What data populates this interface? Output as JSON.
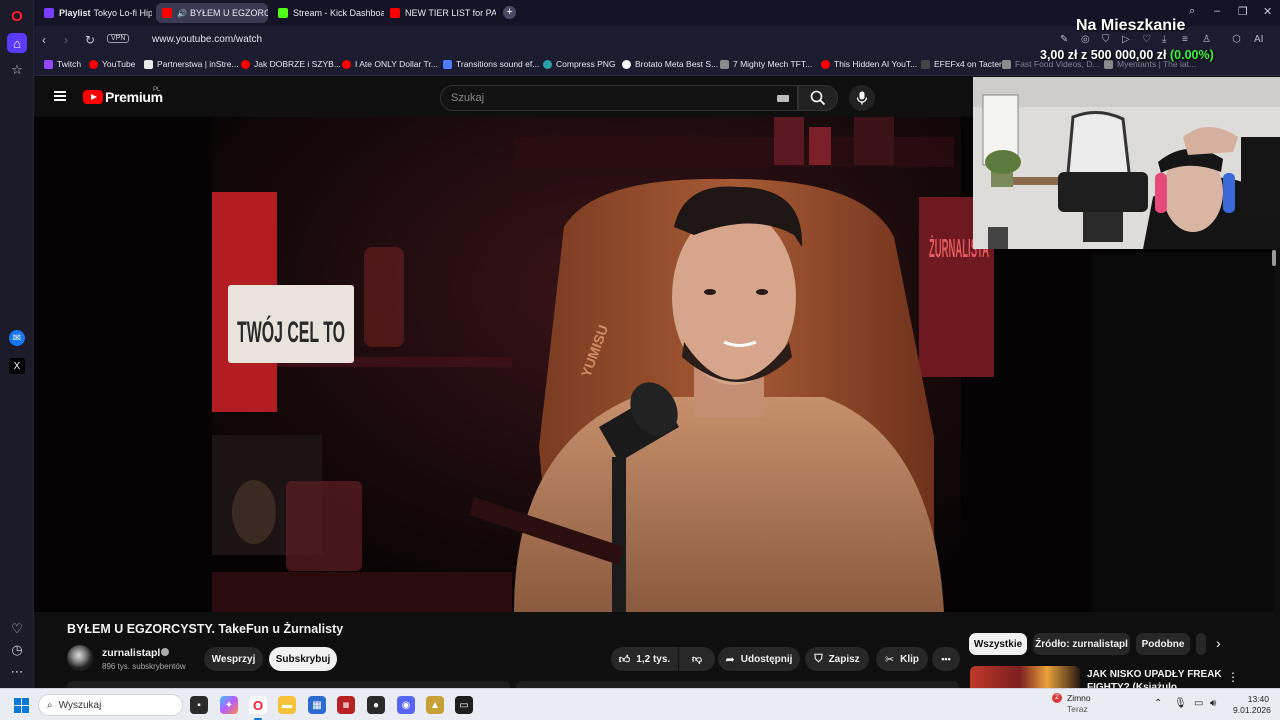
{
  "browser": {
    "tabs": [
      {
        "bold": "Playlist",
        "text": "Tokyo Lo-fi Hiphop",
        "icon": "lofi"
      },
      {
        "bold": "",
        "text": "BYŁEM U EGZORCYSTY",
        "icon": "youtube"
      },
      {
        "bold": "",
        "text": "Stream - Kick Dashboard",
        "icon": "kick"
      },
      {
        "bold": "",
        "text": "NEW TIER LIST for PATCH",
        "icon": "youtube"
      }
    ],
    "new_tab": "+",
    "url": "www.youtube.com/watch",
    "vpn_label": "VPN",
    "bookmarks": [
      {
        "label": "Twitch",
        "icon": "tw"
      },
      {
        "label": "YouTube",
        "icon": "yt"
      },
      {
        "label": "Partnerstwa | inStre...",
        "icon": "doc"
      },
      {
        "label": "Jak DOBRZE i SZYB...",
        "icon": "yt"
      },
      {
        "label": "I Ate ONLY Dollar Tr...",
        "icon": "yt"
      },
      {
        "label": "Transitions sound ef...",
        "icon": "blue"
      },
      {
        "label": "Compress PNG",
        "icon": "teal"
      },
      {
        "label": "Brotato Meta Best S...",
        "icon": "white"
      },
      {
        "label": "7 Mighty Mech TFT...",
        "icon": "gray"
      },
      {
        "label": "This Hidden AI YouT...",
        "icon": "yt"
      },
      {
        "label": "EFEFx4 on Tacter",
        "icon": "dark"
      },
      {
        "label": "Fast Food Videos, D...",
        "icon": "gray"
      },
      {
        "label": "Myentants | The lat...",
        "icon": "gray"
      }
    ]
  },
  "youtube": {
    "logo_text": "Premium",
    "logo_region": "PL",
    "search_placeholder": "Szukaj",
    "video_title": "BYŁEM U EGZORCYSTY. TakeFun u Żurnalisty",
    "channel_name": "zurnalistapl",
    "channel_subs": "896 tys. subskrybentów",
    "support_label": "Wesprzyj",
    "subscribe_label": "Subskrybuj",
    "like_count": "1,2 tys.",
    "share_label": "Udostępnij",
    "save_label": "Zapisz",
    "clip_label": "Klip",
    "more_label": "•••",
    "chips": [
      "Wszystkie",
      "Źródło: zurnalistapl",
      "Podobne"
    ],
    "recommended_title": "JAK NISKO UPADŁY FREAK FIGHTY? (Książulo, Żurnalista..."
  },
  "video_scene": {
    "sign_text": "TWÓJ CEL TO",
    "chair_brand": "YUMISU",
    "poster_text": "ŻURNALISTA"
  },
  "stream_overlay": {
    "title": "Na Mieszkanie",
    "goal_current": "3,00 zł",
    "goal_joiner": "z",
    "goal_target": "500 000,00 zł",
    "goal_percent": "(0.00%)"
  },
  "taskbar": {
    "search_placeholder": "Wyszukaj",
    "weather_temp_badge": "2",
    "weather_label": "Zimno",
    "weather_sub": "Teraz",
    "time": "13:40",
    "date": "9.01.2026"
  },
  "colors": {
    "youtube_red": "#ff0000",
    "kick_green": "#53fc18",
    "opera_red": "#ff1b2d",
    "goal_green": "#3cf53c",
    "windows_blue": "#0a7ad6"
  }
}
